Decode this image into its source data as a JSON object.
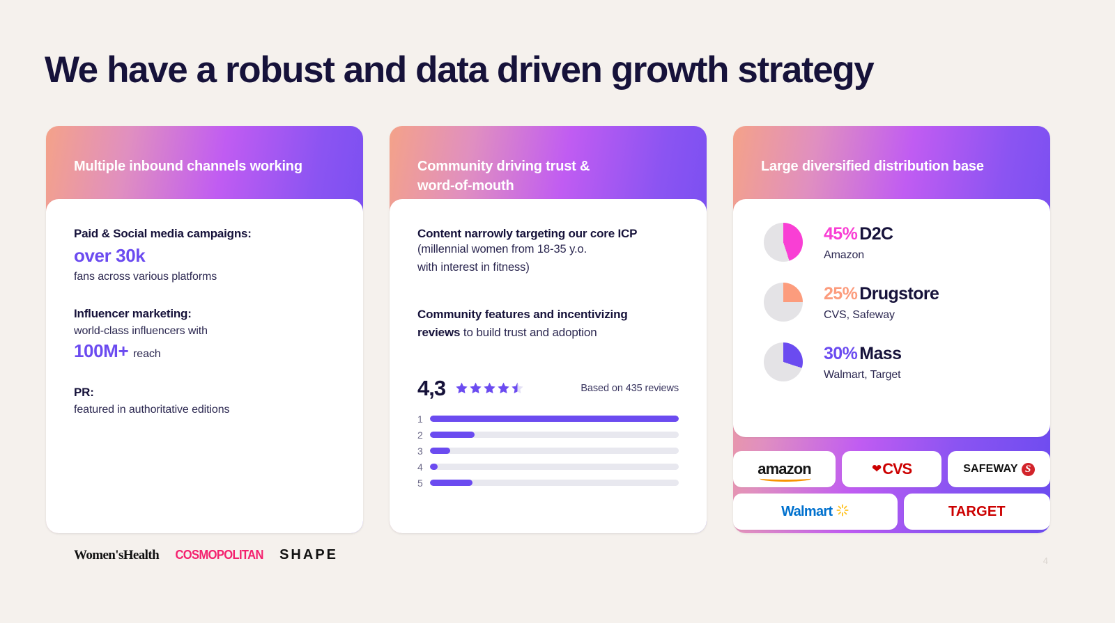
{
  "slide": {
    "title": "We have a robust and data driven growth strategy",
    "page_number": "4",
    "background_color": "#F5F1ED",
    "accent_violet": "#6B4BF0",
    "accent_magenta": "#F93FD4",
    "accent_salmon": "#FC9C7D"
  },
  "cards": [
    {
      "header": "Multiple inbound channels working",
      "blocks": [
        {
          "head": "Paid & Social media campaigns:",
          "big": "over 30k",
          "sub": "fans across various platforms"
        },
        {
          "head": "Influencer marketing:",
          "sub": "world-class influencers with",
          "big": "100M+",
          "big_suffix": "reach"
        },
        {
          "head": "PR:",
          "sub": "featured in authoritative editions"
        }
      ],
      "press_logos": [
        {
          "name": "Women'sHealth",
          "color": "#111111"
        },
        {
          "name": "COSMOPOLITAN",
          "color": "#F4206E"
        },
        {
          "name": "SHAPE",
          "color": "#111111"
        }
      ]
    },
    {
      "header": "Community driving trust &\nword-of-mouth",
      "point1_bold": "Content narrowly targeting our core ICP",
      "point1_line2": "(millennial women from 18-35 y.o.",
      "point1_line3": "with interest in fitness)",
      "point2_bold_a": "Community features and incentivizing",
      "point2_bold_b": "reviews",
      "point2_rest": " to build trust and adoption",
      "rating": {
        "score": "4,3",
        "stars_full": 4,
        "stars_half": 1,
        "based_on": "Based on 435 reviews"
      },
      "histogram": {
        "rows": [
          {
            "label": "1",
            "percent": 100
          },
          {
            "label": "2",
            "percent": 18
          },
          {
            "label": "3",
            "percent": 8
          },
          {
            "label": "4",
            "percent": 3
          },
          {
            "label": "5",
            "percent": 17
          }
        ]
      }
    },
    {
      "header": "Large diversified distribution base",
      "distribution": [
        {
          "pct": "45%",
          "label": "D2C",
          "sub": "Amazon",
          "value": 45,
          "color": "#F93FD4"
        },
        {
          "pct": "25%",
          "label": "Drugstore",
          "sub": "CVS, Safeway",
          "value": 25,
          "color": "#FC9C7D"
        },
        {
          "pct": "30%",
          "label": "Mass",
          "sub": "Walmart, Target",
          "value": 30,
          "color": "#6B4BF0"
        }
      ],
      "retail_logos": [
        {
          "name": "amazon",
          "color": "#161616"
        },
        {
          "name": "CVS",
          "color": "#CC0000"
        },
        {
          "name": "SAFEWAY",
          "color": "#111111"
        },
        {
          "name": "Walmart",
          "color": "#0071CE"
        },
        {
          "name": "TARGET",
          "color": "#CC0000"
        }
      ]
    }
  ],
  "chart_data": [
    {
      "type": "bar",
      "title": "Review rating distribution",
      "categories": [
        "1",
        "2",
        "3",
        "4",
        "5"
      ],
      "values": [
        100,
        18,
        8,
        3,
        17
      ],
      "xlabel": "",
      "ylabel": "",
      "xlim": [
        0,
        100
      ],
      "orientation": "horizontal",
      "grid": false,
      "legend": "none",
      "annotations": [
        "4,3",
        "Based on 435 reviews"
      ]
    },
    {
      "type": "pie",
      "title": "Large diversified distribution base",
      "categories": [
        "D2C",
        "Drugstore",
        "Mass"
      ],
      "values": [
        45,
        25,
        30
      ],
      "labels": [
        "45% D2C",
        "25% Drugstore",
        "30% Mass"
      ],
      "sublabels": [
        "Amazon",
        "CVS, Safeway",
        "Walmart, Target"
      ],
      "colors": [
        "#F93FD4",
        "#FC9C7D",
        "#6B4BF0"
      ],
      "legend": "right",
      "note": "each pie is rendered separately showing its own share of the whole"
    }
  ]
}
